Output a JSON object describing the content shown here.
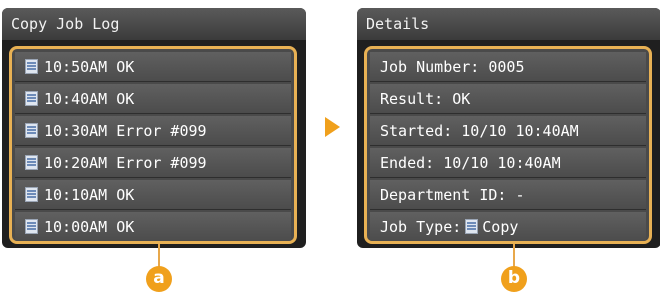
{
  "left_panel": {
    "title": "Copy Job Log",
    "items": [
      {
        "label": "10:50AM OK",
        "icon": "copy-job-icon"
      },
      {
        "label": "10:40AM OK",
        "icon": "copy-job-icon"
      },
      {
        "label": "10:30AM Error #099",
        "icon": "copy-job-icon"
      },
      {
        "label": "10:20AM Error #099",
        "icon": "copy-job-icon"
      },
      {
        "label": "10:10AM OK",
        "icon": "copy-job-icon"
      },
      {
        "label": "10:00AM OK",
        "icon": "copy-job-icon"
      }
    ]
  },
  "right_panel": {
    "title": "Details",
    "job_number": "Job Number: 0005",
    "result": "Result: OK",
    "started": "Started: 10/10 10:40AM",
    "ended": "Ended: 10/10 10:40AM",
    "department": "Department ID: -",
    "job_type_label": "Job Type:",
    "job_type_value": "Copy"
  },
  "callouts": {
    "a": "a",
    "b": "b"
  },
  "colors": {
    "accent": "#f0a01c",
    "frame": "#e8b154",
    "panel_bg": "#1f1f1f"
  }
}
